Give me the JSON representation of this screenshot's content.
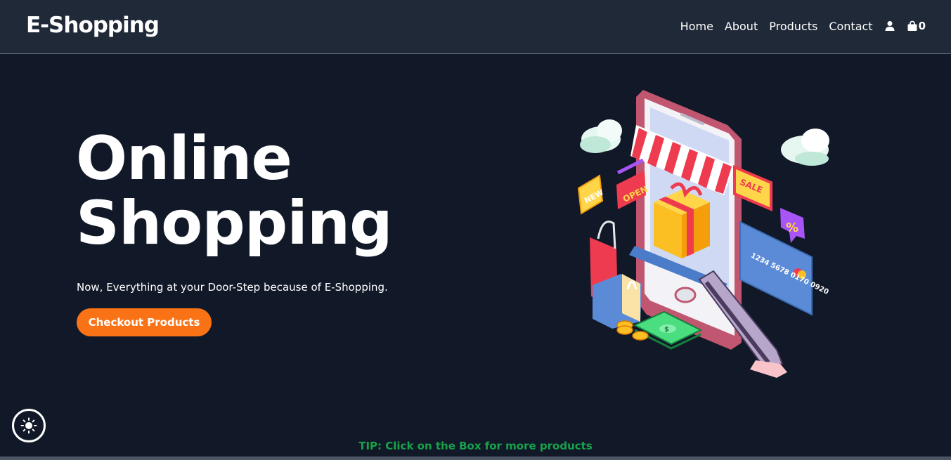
{
  "header": {
    "brand": "E-Shopping",
    "nav": {
      "home": "Home",
      "about": "About",
      "products": "Products",
      "contact": "Contact"
    },
    "cart_count": "0"
  },
  "hero": {
    "title_line1": "Online",
    "title_line2": "Shopping",
    "subtitle": "Now, Everything at your Door-Step because of E-Shopping.",
    "cta_label": "Checkout Products",
    "illustration_labels": {
      "new": "NEW",
      "open": "OPEN",
      "sale": "SALE",
      "percent": "%",
      "card_number": "1234 5678 0170 0920",
      "dollar": "$"
    }
  },
  "tip": "TIP: Click on the Box for more products",
  "colors": {
    "background": "#111827",
    "navbar": "#1f2937",
    "accent": "#f97316",
    "tip": "#16a34a"
  },
  "icons": [
    "user-icon",
    "shopping-bag-icon",
    "sun-icon"
  ]
}
